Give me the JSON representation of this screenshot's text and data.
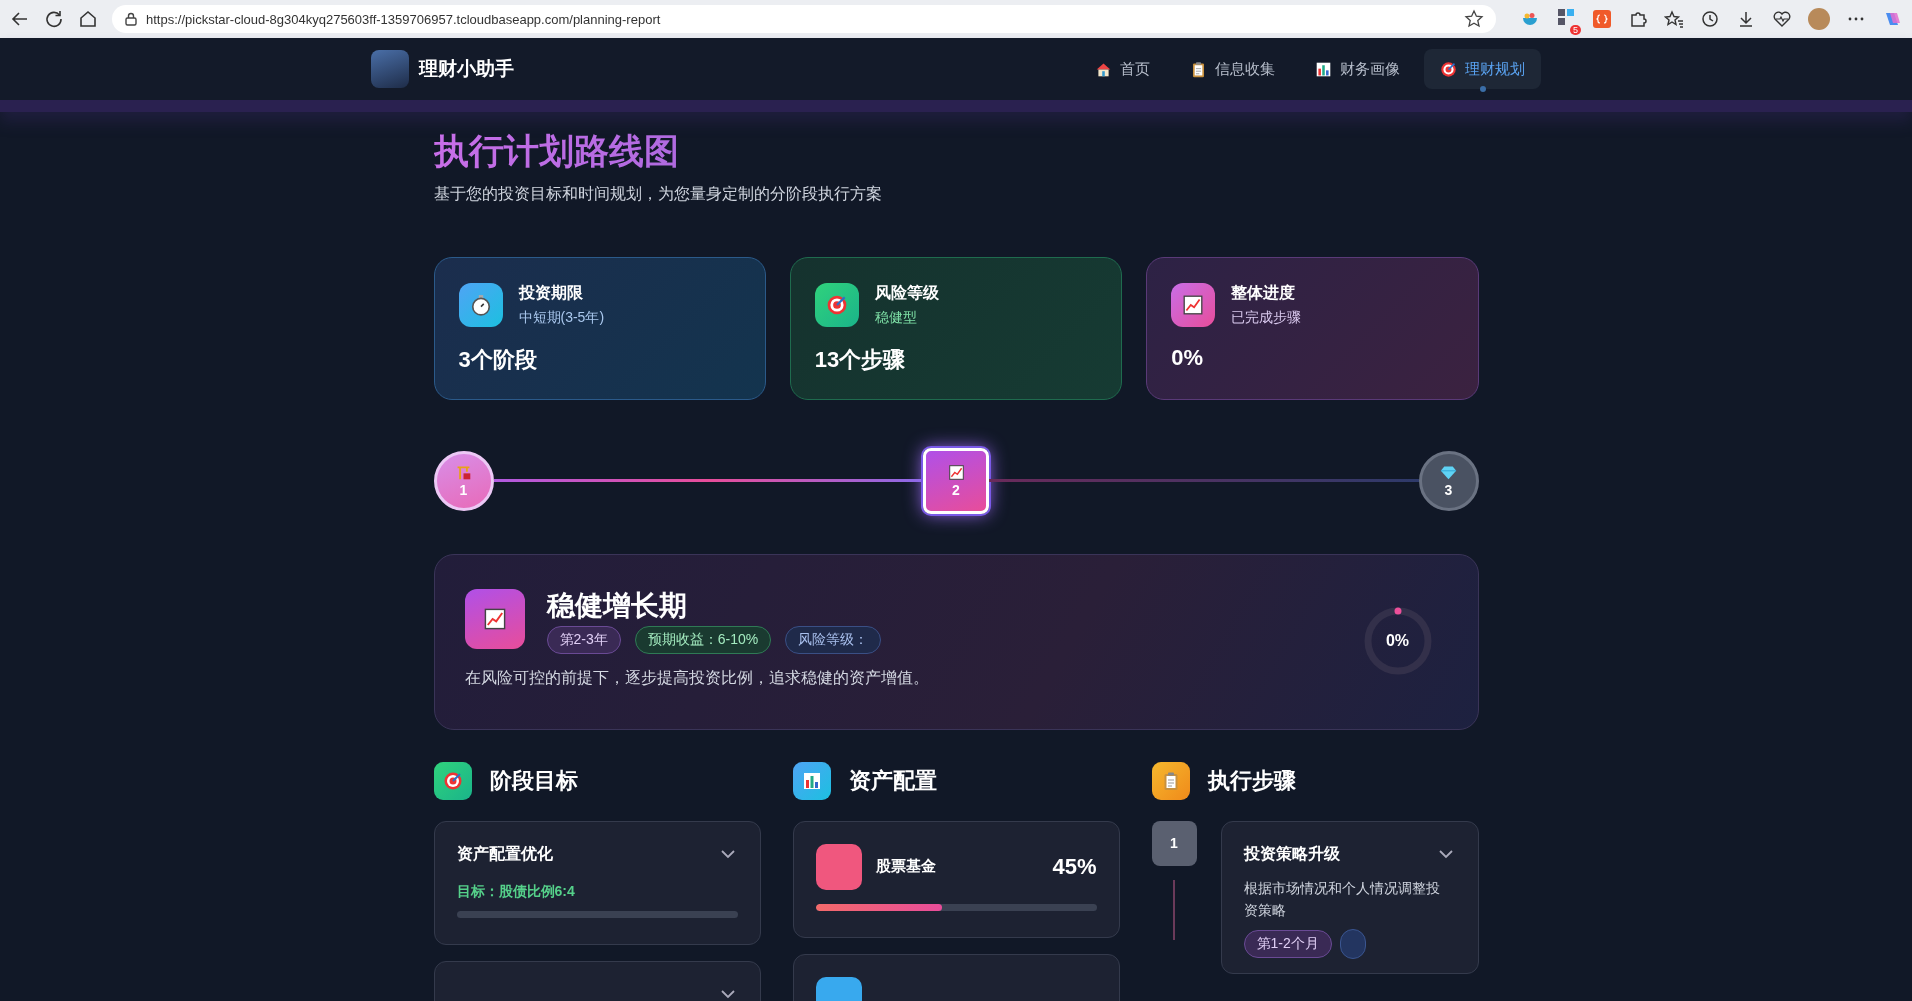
{
  "browser": {
    "url": "https://pickstar-cloud-8g304kyq275603ff-1359706957.tcloudbaseapp.com/planning-report",
    "extension_badge": "5"
  },
  "nav": {
    "brand": "理财小助手",
    "items": [
      {
        "label": "首页",
        "selected": false
      },
      {
        "label": "信息收集",
        "selected": false
      },
      {
        "label": "财务画像",
        "selected": false
      },
      {
        "label": "理财规划",
        "selected": true
      }
    ]
  },
  "header": {
    "title": "执行计划路线图",
    "subtitle": "基于您的投资目标和时间规划，为您量身定制的分阶段执行方案"
  },
  "stats": [
    {
      "kind": "blue",
      "title": "投资期限",
      "subtitle": "中短期(3-5年)",
      "value": "3个阶段"
    },
    {
      "kind": "green",
      "title": "风险等级",
      "subtitle": "稳健型",
      "value": "13个步骤"
    },
    {
      "kind": "purple",
      "title": "整体进度",
      "subtitle": "已完成步骤",
      "value": "0%"
    }
  ],
  "timeline": {
    "nodes": [
      {
        "number": "1",
        "reached": true,
        "selected": false
      },
      {
        "number": "2",
        "reached": true,
        "selected": true
      },
      {
        "number": "3",
        "reached": false,
        "selected": false
      }
    ]
  },
  "phase": {
    "title": "稳健增长期",
    "tags": [
      {
        "kind": "period",
        "label": "第2-3年"
      },
      {
        "kind": "return",
        "label": "预期收益：6-10%"
      },
      {
        "kind": "risk",
        "label": "风险等级："
      }
    ],
    "description": "在风险可控的前提下，逐步提高投资比例，追求稳健的资产增值。",
    "progress": "0%",
    "level": 0
  },
  "goals": {
    "title": "阶段目标",
    "items": [
      {
        "title": "资产配置优化",
        "target": "目标：股债比例6:4",
        "level": 0,
        "expanded": false
      },
      {
        "expanded": false
      }
    ]
  },
  "assets": {
    "title": "资产配置",
    "items": [
      {
        "name": "股票基金",
        "percent": "45%",
        "level": 0.45,
        "color": "#f0577e"
      },
      {
        "color": "#38a9ee"
      }
    ]
  },
  "steps": {
    "title": "执行步骤",
    "items": [
      {
        "number": "1",
        "done": false,
        "title": "投资策略升级",
        "description": "根据市场情况和个人情况调整投资策略",
        "tag": "第1-2个月",
        "expanded": false
      }
    ]
  }
}
